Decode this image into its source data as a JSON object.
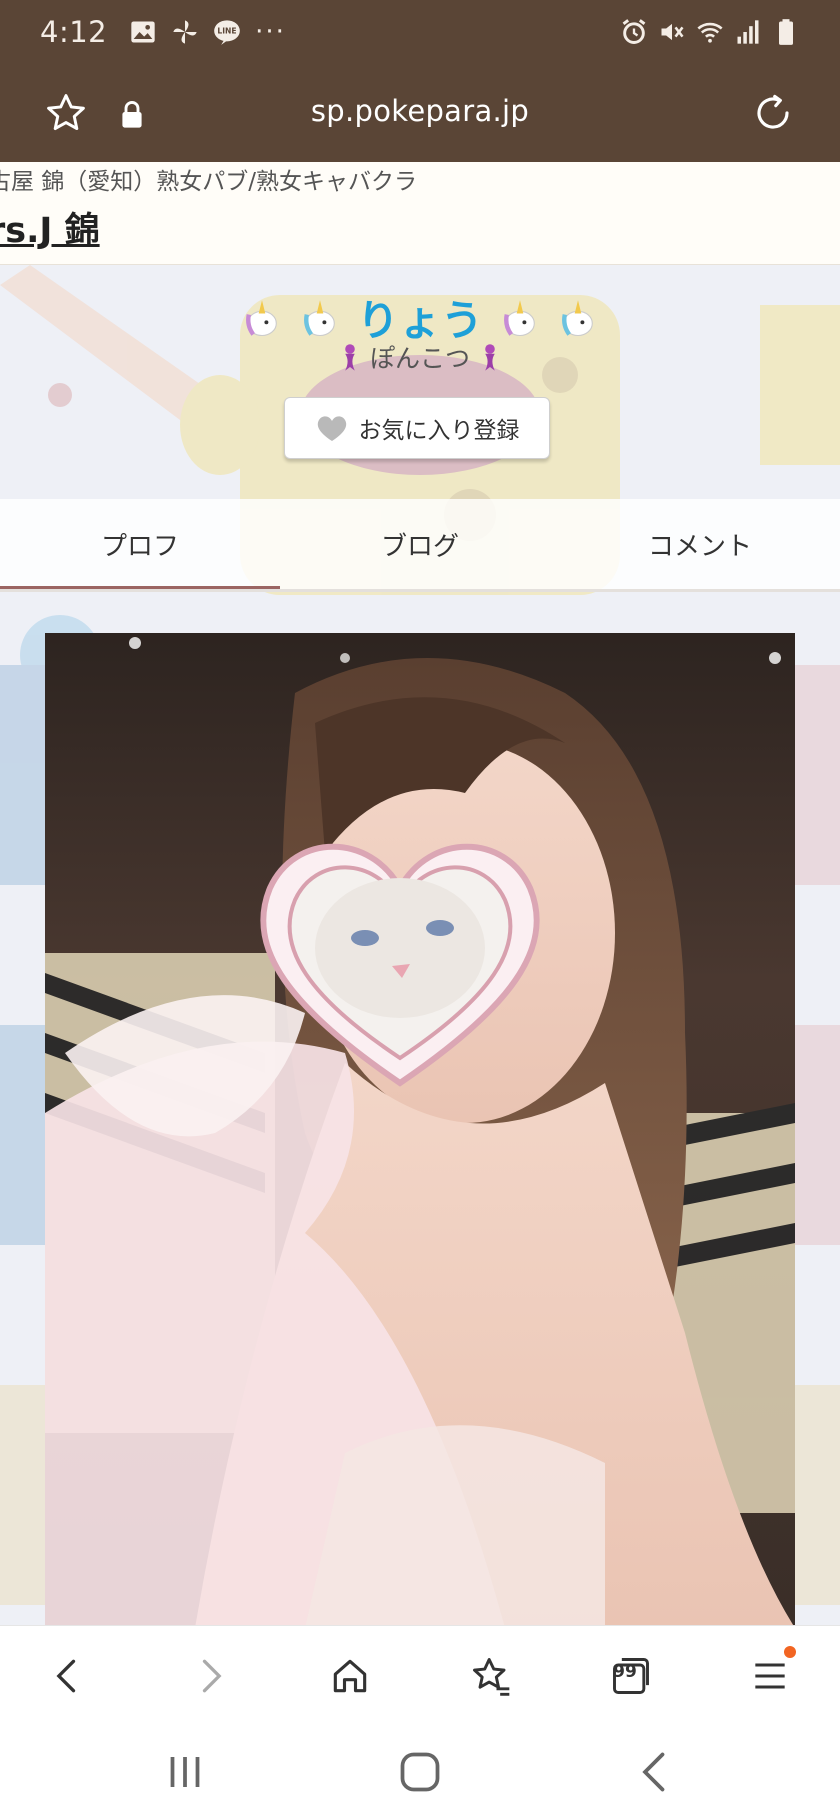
{
  "status_bar": {
    "time": "4:12",
    "left_icons": [
      "gallery-icon",
      "pinwheel-icon",
      "line-app-icon",
      "more-dots-icon"
    ],
    "more_dots": "···",
    "right_icons": [
      "alarm-icon",
      "mute-icon",
      "wifi-icon",
      "signal-icon",
      "battery-icon"
    ]
  },
  "url_bar": {
    "url": "sp.pokepara.jp"
  },
  "site_header": {
    "breadcrumb": "古屋 錦（愛知）熟女パブ/熟女キャバクラ",
    "shop_name": "rs.J 錦"
  },
  "profile": {
    "name": "りょう",
    "catchphrase": "ぽんこつ",
    "favorite_button": "お気に入り登録"
  },
  "tabs": [
    {
      "label": "プロフ",
      "active": true
    },
    {
      "label": "ブログ",
      "active": false
    },
    {
      "label": "コメント",
      "active": false
    }
  ],
  "browser_toolbar": {
    "tabs_count": "99",
    "menu_badge_color": "#f26522"
  },
  "colors": {
    "status_bar_bg": "#5a4536",
    "name_color": "#1ea0d8",
    "active_tab_underline": "#9b6562"
  }
}
